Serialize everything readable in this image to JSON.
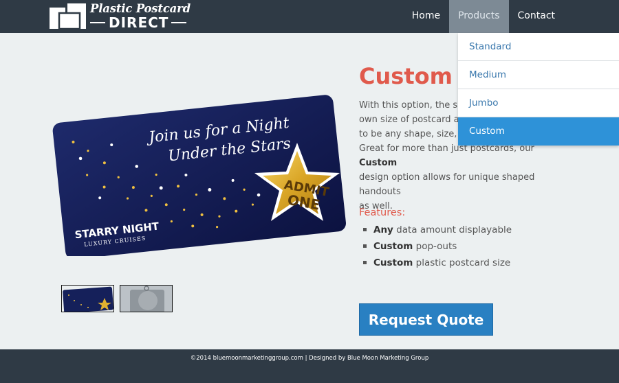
{
  "header": {
    "logo_line1": "Plastic Postcard",
    "logo_line2": "DIRECT",
    "nav": [
      {
        "label": "Home"
      },
      {
        "label": "Products"
      },
      {
        "label": "Contact"
      }
    ]
  },
  "dropdown": {
    "items": [
      {
        "label": "Standard"
      },
      {
        "label": "Medium"
      },
      {
        "label": "Jumbo"
      },
      {
        "label": "Custom"
      }
    ],
    "selected": "Custom"
  },
  "card": {
    "headline_line1": "Join us for a Night",
    "headline_line2": "Under the Stars",
    "badge_line1": "ADMIT",
    "badge_line2": "ONE",
    "brand_line1": "STARRY NIGHT",
    "brand_line2": "LUXURY CRUISES"
  },
  "thumbnails": [
    {
      "alt": "Join us for a Night Under the Stars"
    },
    {
      "alt": "Happy Holidays"
    }
  ],
  "product": {
    "title": "Custom",
    "desc_part1": "With this option, the sky",
    "desc_part2": "own size of postcard and",
    "desc_part3": "to be any shape, size, an",
    "desc_part4": "Great for more than just postcards, our ",
    "desc_bold": "Custom",
    "desc_part5": "design option allows for unique shaped handouts",
    "desc_part6": "as well.",
    "features_title": "Features:",
    "features": [
      {
        "bold": "Any",
        "rest": " data amount displayable"
      },
      {
        "bold": "Custom",
        "rest": " pop-outs"
      },
      {
        "bold": "Custom",
        "rest": " plastic postcard size"
      }
    ],
    "cta_label": "Request Quote"
  },
  "footer": {
    "text": "©2014 bluemoonmarketinggroup.com | Designed by Blue Moon Marketing Group"
  },
  "colors": {
    "header_bg": "#2f3a45",
    "accent_red": "#e05a4c",
    "button_blue": "#2980c2",
    "dropdown_active": "#2e92d8",
    "link_blue": "#3a78ad",
    "page_bg": "#ecf0f1"
  }
}
